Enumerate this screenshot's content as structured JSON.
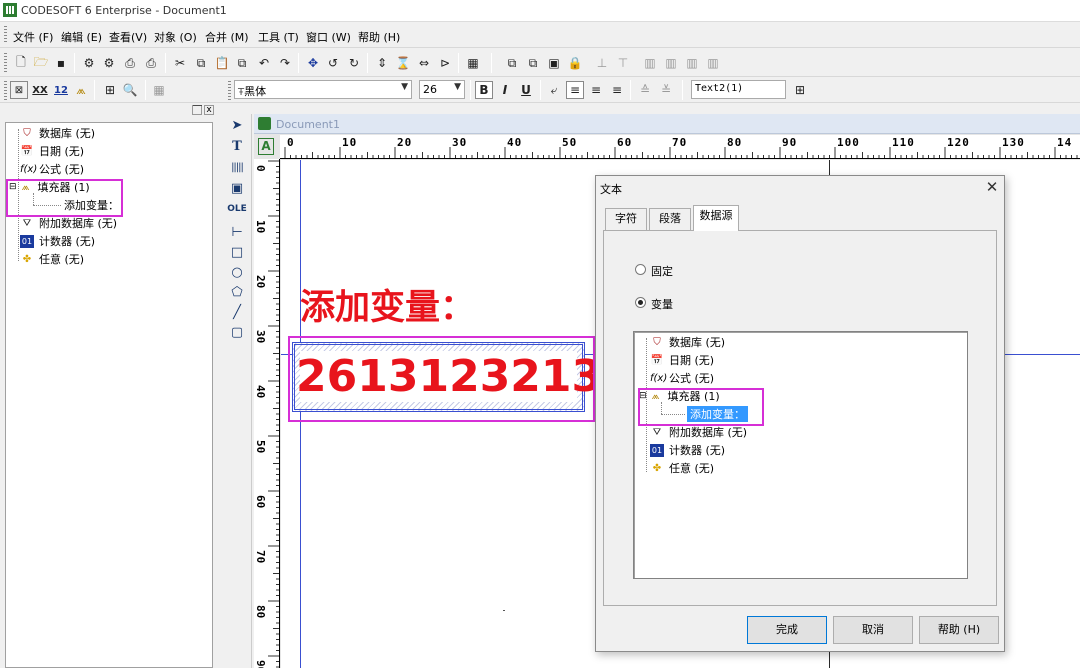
{
  "window": {
    "title": "CODESOFT 6 Enterprise - Document1"
  },
  "menu": [
    "文件 (F)",
    "编辑 (E)",
    "查看(V)",
    "对象 (O)",
    "合并 (M)",
    "工具 (T)",
    "窗口 (W)",
    "帮助 (H)"
  ],
  "format_bar": {
    "font_name": "黑体",
    "font_size": "26",
    "bold": "B",
    "italic": "I",
    "underline": "U",
    "text_object": "Text2(1)"
  },
  "icons": {
    "toolbar1": [
      "new-document-icon",
      "open-folder-icon",
      "save-icon",
      "print-setup-icon",
      "print-preview-icon",
      "print-icon",
      "print-labels-icon",
      "cut-icon",
      "copy-icon",
      "paste-icon",
      "duplicate-icon",
      "undo-icon",
      "redo-icon",
      "move-icon",
      "rotate-left-icon",
      "rotate-right-icon",
      "vertical-resize-icon",
      "hourglass-icon",
      "horizontal-resize-icon",
      "mirror-icon",
      "calculator-icon",
      "bring-front-icon",
      "send-back-icon",
      "properties-icon",
      "lock-icon",
      "align-bottom-icon",
      "align-top-icon",
      "distribute-1-icon",
      "distribute-2-icon",
      "distribute-3-icon",
      "distribute-4-icon"
    ],
    "toolbar2": [
      "variable-icon",
      "counter-icon",
      "number-icon",
      "filler-icon",
      "tree-icon",
      "zoom-icon",
      "grid-icon"
    ],
    "tools": [
      "pointer-tool-icon",
      "text-tool-icon",
      "barcode-tool-icon",
      "image-tool-icon",
      "ole-tool-icon",
      "line-tool-icon",
      "rectangle-tool-icon",
      "ellipse-tool-icon",
      "polygon-tool-icon",
      "diagonal-line-tool-icon",
      "rounded-rect-tool-icon"
    ]
  },
  "tools": {
    "text": "T",
    "ole": "OLE"
  },
  "left_tree": {
    "items": [
      {
        "label": "数据库 (无)",
        "icon": "database-icon"
      },
      {
        "label": "日期 (无)",
        "icon": "calendar-icon"
      },
      {
        "label": "公式 (无)",
        "icon": "formula-icon"
      },
      {
        "label": "填充器 (1)",
        "icon": "filler-icon",
        "expand": "⊟"
      },
      {
        "label": "添加变量：",
        "icon": ""
      },
      {
        "label": "附加数据库 (无)",
        "icon": "extra-database-icon"
      },
      {
        "label": "计数器 (无)",
        "icon": "counter-icon"
      },
      {
        "label": "任意 (无)",
        "icon": "free-icon"
      }
    ]
  },
  "document": {
    "title": "Document1",
    "ruler_h": [
      "0",
      "10",
      "20",
      "30",
      "40",
      "50",
      "60",
      "70",
      "80",
      "90",
      "100",
      "110",
      "120",
      "130",
      "14"
    ],
    "ruler_v": [
      "0",
      "10",
      "20",
      "30",
      "40",
      "50",
      "60",
      "70",
      "80",
      "90"
    ],
    "label_text": "添加变量：",
    "variable_value": "2613123213",
    "text_color": "#e8141c"
  },
  "dialog": {
    "title": "文本",
    "close": "✕",
    "tabs": [
      "字符",
      "段落",
      "数据源"
    ],
    "active_tab": "数据源",
    "radio_fixed": "固定",
    "radio_variable": "变量",
    "selected_radio": "变量",
    "tree": [
      {
        "label": "数据库 (无)",
        "icon": "database-icon"
      },
      {
        "label": "日期 (无)",
        "icon": "calendar-icon"
      },
      {
        "label": "公式 (无)",
        "icon": "formula-icon"
      },
      {
        "label": "填充器 (1)",
        "icon": "filler-icon"
      },
      {
        "label": "添加变量：",
        "icon": ""
      },
      {
        "label": "附加数据库 (无)",
        "icon": "extra-database-icon"
      },
      {
        "label": "计数器 (无)",
        "icon": "counter-icon"
      },
      {
        "label": "任意 (无)",
        "icon": "free-icon"
      }
    ],
    "buttons": {
      "ok": "完成",
      "cancel": "取消",
      "help": "帮助 (H)"
    }
  },
  "colors": {
    "highlight_box": "#d62fd6",
    "selection": "#3399ff",
    "red_text": "#e8141c"
  }
}
